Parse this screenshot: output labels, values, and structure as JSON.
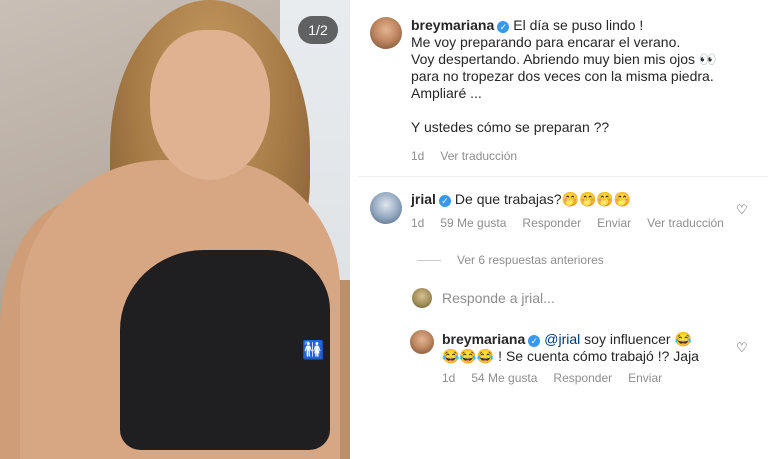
{
  "photo": {
    "page_indicator": "1/2"
  },
  "caption": {
    "username": "breymariana",
    "verified_mark": "✓",
    "lines": [
      "El día se puso lindo !",
      "Me voy preparando para encarar el verano.",
      "Voy despertando. Abriendo muy bien mis ojos 👀",
      "para no tropezar dos veces con la misma piedra.",
      "Ampliaré ...",
      "",
      "Y ustedes cómo se preparan ??"
    ],
    "time": "1d",
    "translate": "Ver traducción"
  },
  "comment1": {
    "username": "jrial",
    "verified_mark": "✓",
    "text": "De que trabajas?🤭🤭🤭🤭",
    "time": "1d",
    "likes": "59 Me gusta",
    "reply": "Responder",
    "send": "Enviar",
    "translate": "Ver traducción"
  },
  "view_replies": "Ver 6 respuestas anteriores",
  "reply_input": {
    "placeholder": "Responde a jrial..."
  },
  "reply1": {
    "username": "breymariana",
    "verified_mark": "✓",
    "mention": "@jrial",
    "text_line1": "soy influencer 😂",
    "text_line2": "😂😂😂 ! Se cuenta cómo trabajó !? Jaja",
    "time": "1d",
    "likes": "54 Me gusta",
    "reply": "Responder",
    "send": "Enviar"
  },
  "icons": {
    "heart": "♡",
    "restroom": "🚻"
  }
}
